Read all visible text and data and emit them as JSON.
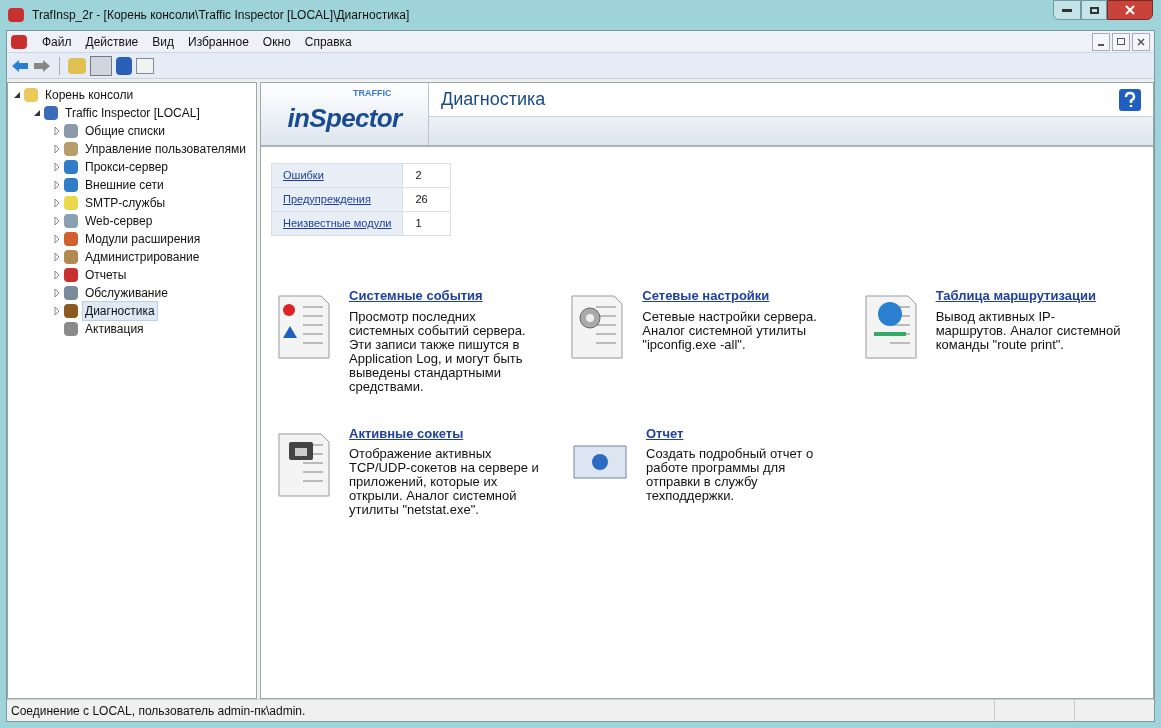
{
  "window": {
    "title": "TrafInsp_2r - [Корень консоли\\Traffic Inspector [LOCAL]\\Диагностика]"
  },
  "menu": [
    "Файл",
    "Действие",
    "Вид",
    "Избранное",
    "Окно",
    "Справка"
  ],
  "tree": [
    {
      "label": "Корень консоли",
      "expanded": true,
      "selected": false,
      "children": [
        {
          "label": "Traffic Inspector [LOCAL]",
          "expanded": true,
          "selected": false,
          "children": [
            {
              "label": "Общие списки",
              "expanded": false,
              "selected": false
            },
            {
              "label": "Управление пользователями",
              "expanded": false,
              "selected": false
            },
            {
              "label": "Прокси-сервер",
              "expanded": false,
              "selected": false
            },
            {
              "label": "Внешние сети",
              "expanded": false,
              "selected": false
            },
            {
              "label": "SMTP-службы",
              "expanded": false,
              "selected": false
            },
            {
              "label": "Web-сервер",
              "expanded": false,
              "selected": false
            },
            {
              "label": "Модули расширения",
              "expanded": false,
              "selected": false
            },
            {
              "label": "Администрирование",
              "expanded": false,
              "selected": false
            },
            {
              "label": "Отчеты",
              "expanded": false,
              "selected": false
            },
            {
              "label": "Обслуживание",
              "expanded": false,
              "selected": false
            },
            {
              "label": "Диагностика",
              "expanded": false,
              "selected": true
            },
            {
              "label": "Активация",
              "selected": false
            }
          ]
        }
      ]
    }
  ],
  "header": {
    "logo_small": "TRAFFIC",
    "logo_main": "inSpector",
    "title": "Диагностика"
  },
  "stats": [
    {
      "label": "Ошибки",
      "value": "2"
    },
    {
      "label": "Предупреждения",
      "value": "26"
    },
    {
      "label": "Неизвестные модули",
      "value": "1"
    }
  ],
  "tasks": [
    {
      "kind": "events",
      "title": "Системные события",
      "description": "Просмотр последних системных событий сервера. Эти записи также пишутся в Application Log, и могут быть выведены стандартными средствами."
    },
    {
      "kind": "network",
      "title": "Сетевые настройки",
      "description": "Сетевые настройки сервера. Аналог системной утилиты \"ipconfig.exe -all\"."
    },
    {
      "kind": "routes",
      "title": "Таблица маршрутизации",
      "description": "Вывод активных IP-маршрутов. Аналог системной команды \"route print\"."
    },
    {
      "kind": "sockets",
      "title": "Активные сокеты",
      "description": "Отображение активных TCP/UDP-сокетов на сервере и приложений, которые их открыли. Аналог системной утилиты \"netstat.exe\"."
    },
    {
      "kind": "report",
      "title": "Отчет",
      "description": "Создать подробный отчет о работе программы для отправки в службу техподдержки."
    }
  ],
  "status_bar": "Соединение с LOCAL, пользователь admin-пк\\admin."
}
